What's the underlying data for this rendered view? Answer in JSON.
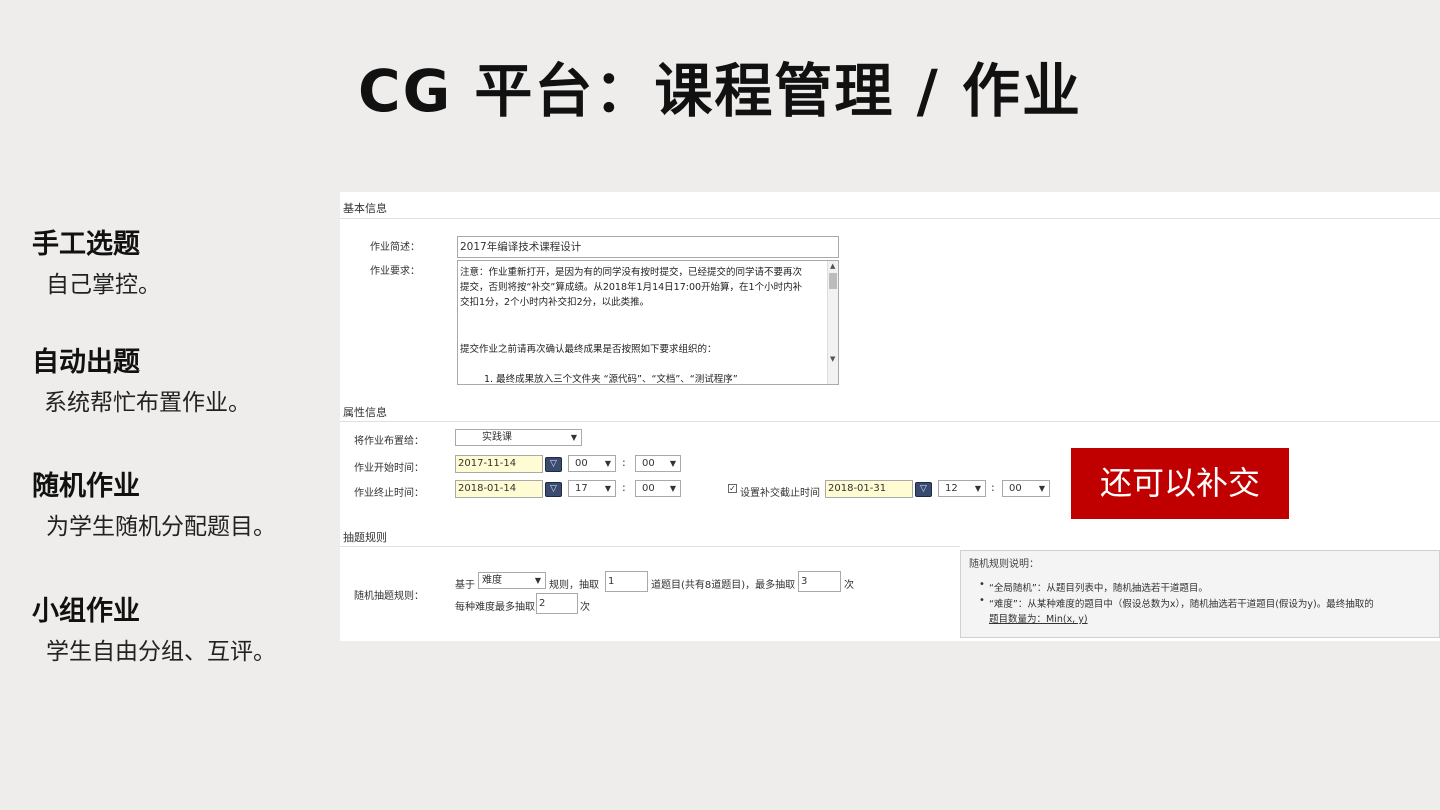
{
  "title": "CG 平台：课程管理  /  作业",
  "features": [
    {
      "title": "手工选题",
      "desc": "自己掌控。"
    },
    {
      "title": "自动出题",
      "desc": "系统帮忙布置作业。"
    },
    {
      "title": "随机作业",
      "desc": "为学生随机分配题目。"
    },
    {
      "title": "小组作业",
      "desc": "学生自由分组、互评。"
    }
  ],
  "basic_info": {
    "header": "基本信息",
    "summary_label": "作业简述：",
    "summary_value": "2017年编译技术课程设计",
    "requirement_label": "作业要求：",
    "requirement_lines": [
      "注意：作业重新打开，是因为有的同学没有按时提交，已经提交的同学请不要再次",
      "提交，否则将按“补交”算成绩。从2018年1月14日17:00开始算，在1个小时内补",
      "交扣1分，2个小时内补交扣2分，以此类推。",
      "提交作业之前请再次确认最终成果是否按照如下要求组织的：",
      "1. 最终成果放入三个文件夹 “源代码”、“文档”、“测试程序”"
    ]
  },
  "attr_info": {
    "header": "属性信息",
    "assign_label": "将作业布置给：",
    "assign_value": "实践课",
    "start_label": "作业开始时间：",
    "start_date": "2017-11-14",
    "start_hour": "00",
    "start_min": "00",
    "end_label": "作业终止时间：",
    "end_date": "2018-01-14",
    "end_hour": "17",
    "end_min": "00",
    "late_checkbox_label": "设置补交截止时间",
    "late_checked": true,
    "late_date": "2018-01-31",
    "late_hour": "12",
    "late_min": "00"
  },
  "draw_rules": {
    "header": "抽题规则",
    "rule_label": "随机抽题规则：",
    "based_on": "基于",
    "rule_select": "难度",
    "rule_text": "规则，抽取",
    "count_value": "1",
    "count_text": "道题目(共有8道题目)，最多抽取",
    "max_value": "3",
    "times_text": "次",
    "per_level_text": "每种难度最多抽取",
    "per_level_value": "2",
    "per_level_times": "次",
    "explain_title": "随机规则说明：",
    "explain_items": [
      "“全局随机”：从题目列表中，随机抽选若干道题目。",
      "“难度”：从某种难度的题目中（假设总数为x），随机抽选若干道题目(假设为y)。最终抽取的",
      "题目数量为：Min(x, y)"
    ]
  },
  "callout": "还可以补交",
  "colors": {
    "callout_bg": "#c00000",
    "date_bg": "#fffbd2",
    "calendar_btn": "#3a4b6e"
  },
  "icons": {
    "calendar": "calendar-icon",
    "dropdown": "chevron-down-icon",
    "checkbox": "checkbox-checked-icon"
  }
}
